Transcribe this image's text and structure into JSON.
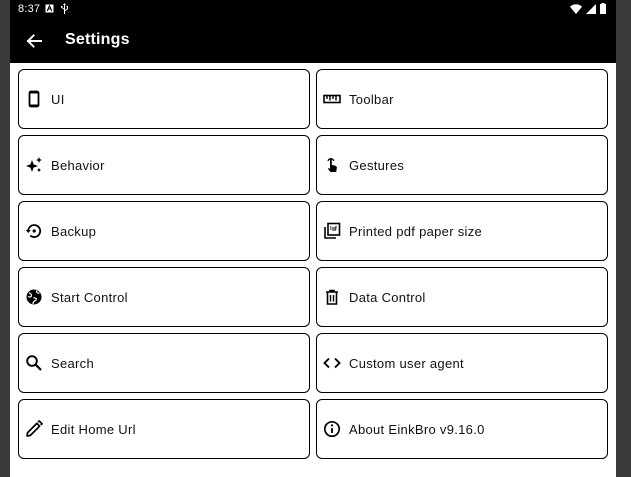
{
  "status": {
    "time": "8:37"
  },
  "appbar": {
    "title": "Settings"
  },
  "items": [
    {
      "label": "UI",
      "icon": "phone-icon"
    },
    {
      "label": "Toolbar",
      "icon": "ruler-icon"
    },
    {
      "label": "Behavior",
      "icon": "sparkle-icon"
    },
    {
      "label": "Gestures",
      "icon": "touch-icon"
    },
    {
      "label": "Backup",
      "icon": "restore-icon"
    },
    {
      "label": "Printed pdf paper size",
      "icon": "pdf-icon"
    },
    {
      "label": "Start Control",
      "icon": "globe-icon"
    },
    {
      "label": "Data Control",
      "icon": "trash-icon"
    },
    {
      "label": "Search",
      "icon": "search-icon"
    },
    {
      "label": "Custom user agent",
      "icon": "code-icon"
    },
    {
      "label": "Edit Home Url",
      "icon": "pencil-icon"
    },
    {
      "label": "About EinkBro v9.16.0",
      "icon": "info-icon"
    }
  ]
}
